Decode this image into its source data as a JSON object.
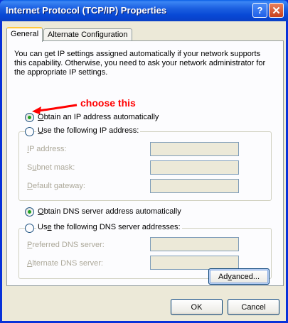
{
  "window": {
    "title": "Internet Protocol (TCP/IP) Properties",
    "help_symbol": "?",
    "close_symbol": "✕"
  },
  "tabs": [
    {
      "label": "General",
      "active": true
    },
    {
      "label": "Alternate Configuration",
      "active": false
    }
  ],
  "description": "You can get IP settings assigned automatically if your network supports this capability. Otherwise, you need to ask your network administrator for the appropriate IP settings.",
  "ip": {
    "auto": {
      "mn": "O",
      "rest": "btain an IP address automatically",
      "checked": true
    },
    "manual": {
      "mn": "U",
      "rest": "se the following IP address:",
      "checked": false
    },
    "fields": [
      {
        "pre": "",
        "mn": "I",
        "rest": "P address:",
        "value": ""
      },
      {
        "pre": "S",
        "mn": "u",
        "rest": "bnet mask:",
        "value": ""
      },
      {
        "pre": "",
        "mn": "D",
        "rest": "efault gateway:",
        "value": ""
      }
    ]
  },
  "dns": {
    "auto": {
      "pre": "",
      "mn": "O",
      "rest": "btain DNS server address automatically",
      "checked": true
    },
    "manual": {
      "pre": "Us",
      "mn": "e",
      "rest": " the following DNS server addresses:",
      "checked": false
    },
    "fields": [
      {
        "pre": "",
        "mn": "P",
        "rest": "referred DNS server:",
        "value": ""
      },
      {
        "pre": "",
        "mn": "A",
        "rest": "lternate DNS server:",
        "value": ""
      }
    ]
  },
  "buttons": {
    "advanced": {
      "pre": "Ad",
      "mn": "v",
      "rest": "anced..."
    },
    "ok": "OK",
    "cancel": "Cancel"
  },
  "annotation": {
    "text": "choose this",
    "color": "#ff0000"
  },
  "colors": {
    "title_bar": "#0a5fe6",
    "dialog_bg": "#ece9d8",
    "radio_dot": "#21a121",
    "tab_highlight": "#ffc83c"
  }
}
